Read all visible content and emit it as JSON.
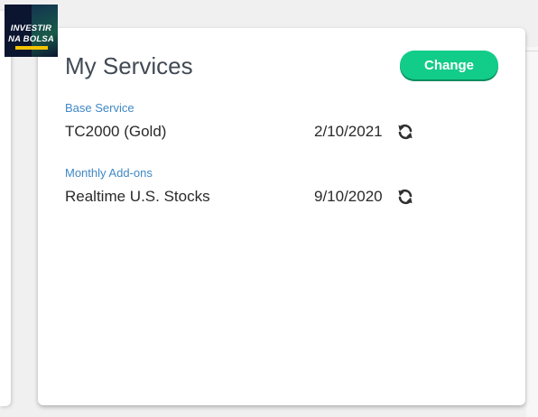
{
  "logo": {
    "line1": "INVESTIR",
    "line2": "NA BOLSA"
  },
  "services": {
    "title": "My Services",
    "change_label": "Change",
    "base": {
      "label": "Base Service",
      "name": "TC2000 (Gold)",
      "date": "2/10/2021",
      "icon": "renew-icon"
    },
    "addons": {
      "label": "Monthly Add-ons",
      "items": [
        {
          "name": "Realtime U.S. Stocks",
          "date": "9/10/2020",
          "icon": "renew-icon"
        }
      ]
    }
  },
  "colors": {
    "accent_button": "#12cc89",
    "section_label": "#3f88c5",
    "title_text": "#424a54"
  }
}
